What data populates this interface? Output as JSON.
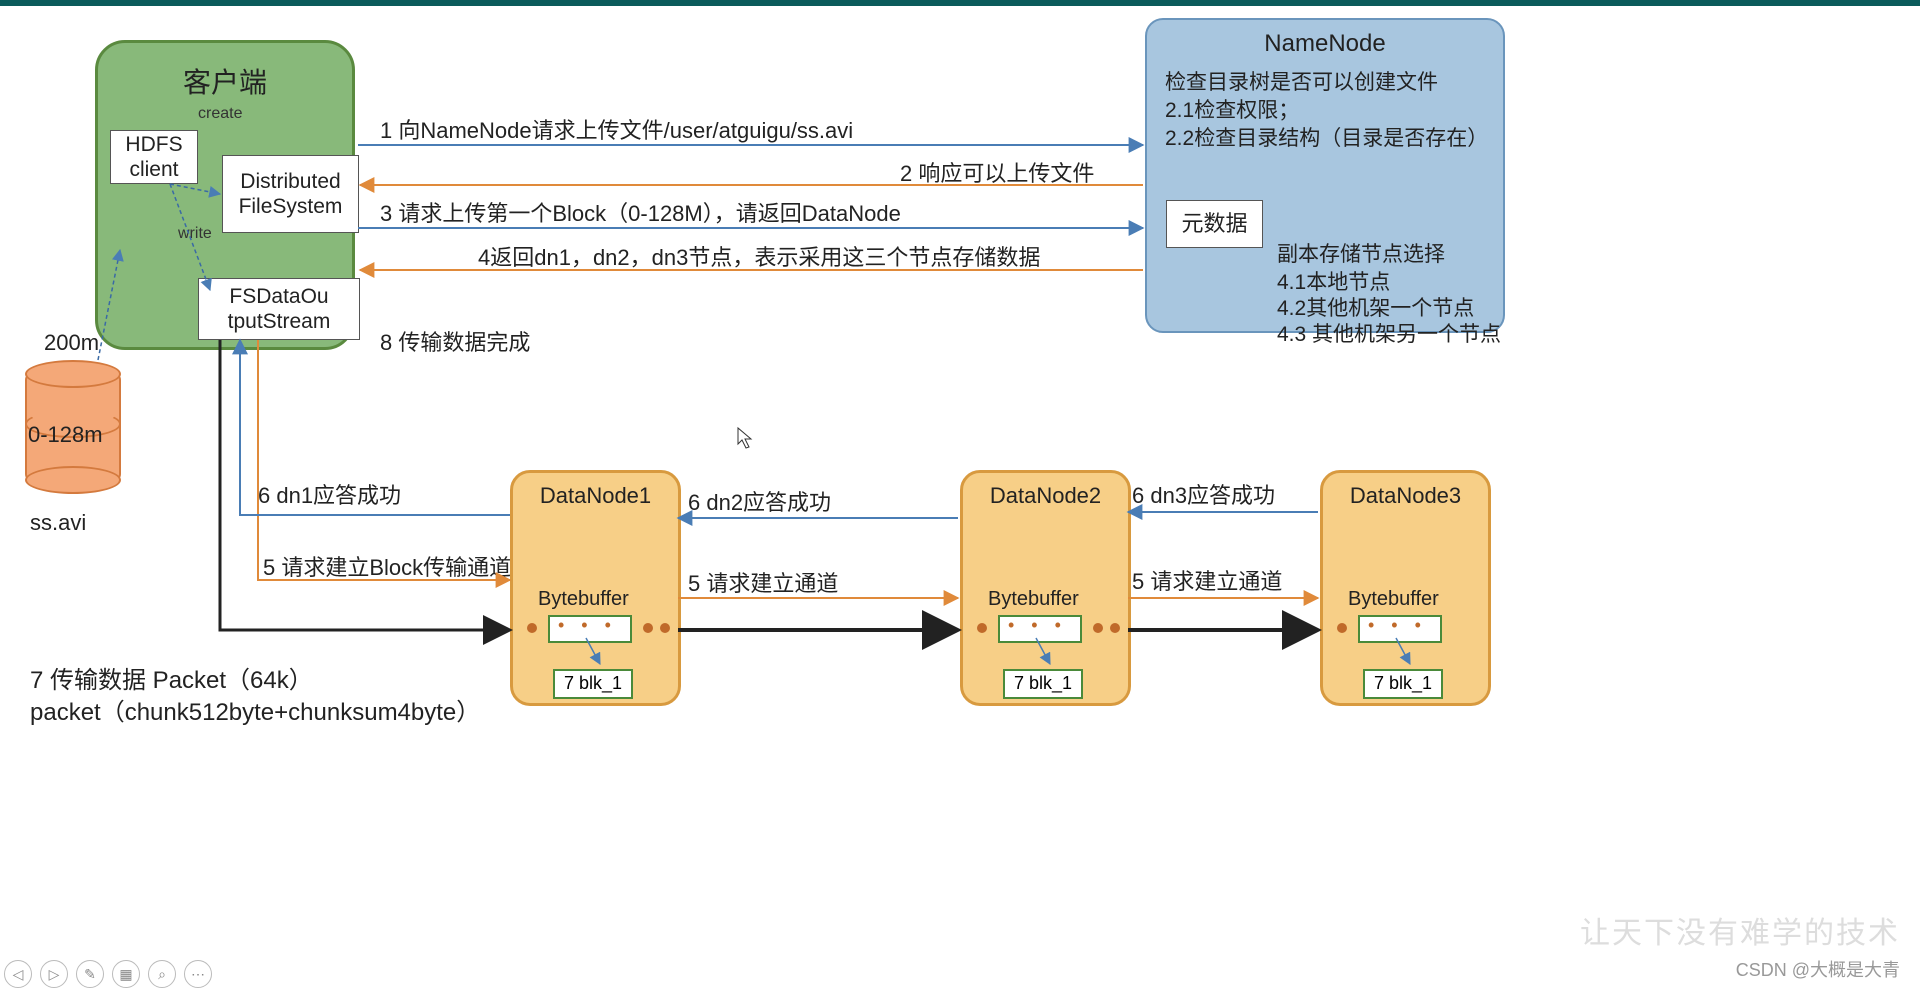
{
  "client": {
    "title": "客户端",
    "create": "create",
    "write": "write",
    "hdfs": "HDFS\nclient",
    "dfs": "Distributed\nFileSystem",
    "fsout": "FSDataOu\ntputStream"
  },
  "namenode": {
    "title": "NameNode",
    "l1": "检查目录树是否可以创建文件",
    "l2": "2.1检查权限；",
    "l3": "2.2检查目录结构（目录是否存在）",
    "meta": "元数据",
    "s1": "副本存储节点选择",
    "s2": "4.1本地节点",
    "s3": "4.2其他机架一个节点",
    "s4": "4.3 其他机架另一个节点"
  },
  "file": {
    "size": "200m",
    "block": "0-128m",
    "name": "ss.avi"
  },
  "steps": {
    "s1": "1 向NameNode请求上传文件/user/atguigu/ss.avi",
    "s2": "2 响应可以上传文件",
    "s3": "3 请求上传第一个Block（0-128M），请返回DataNode",
    "s4": "4返回dn1，dn2，dn3节点，表示采用这三个节点存储数据",
    "s5a": "5 请求建立Block传输通道",
    "s5b": "5 请求建立通道",
    "s5c": "5 请求建立通道",
    "s6a": "6 dn1应答成功",
    "s6b": "6 dn2应答成功",
    "s6c": "6 dn3应答成功",
    "s7": "7 传输数据  Packet（64k）",
    "s7b": "packet（chunk512byte+chunksum4byte）",
    "s8": "8 传输数据完成"
  },
  "datanodes": [
    {
      "title": "DataNode1",
      "bb": "Bytebuffer",
      "blk": "7 blk_1"
    },
    {
      "title": "DataNode2",
      "bb": "Bytebuffer",
      "blk": "7 blk_1"
    },
    {
      "title": "DataNode3",
      "bb": "Bytebuffer",
      "blk": "7 blk_1"
    }
  ],
  "footer": {
    "csdn": "CSDN @大概是大青",
    "tagline": "让天下没有难学的技术"
  }
}
